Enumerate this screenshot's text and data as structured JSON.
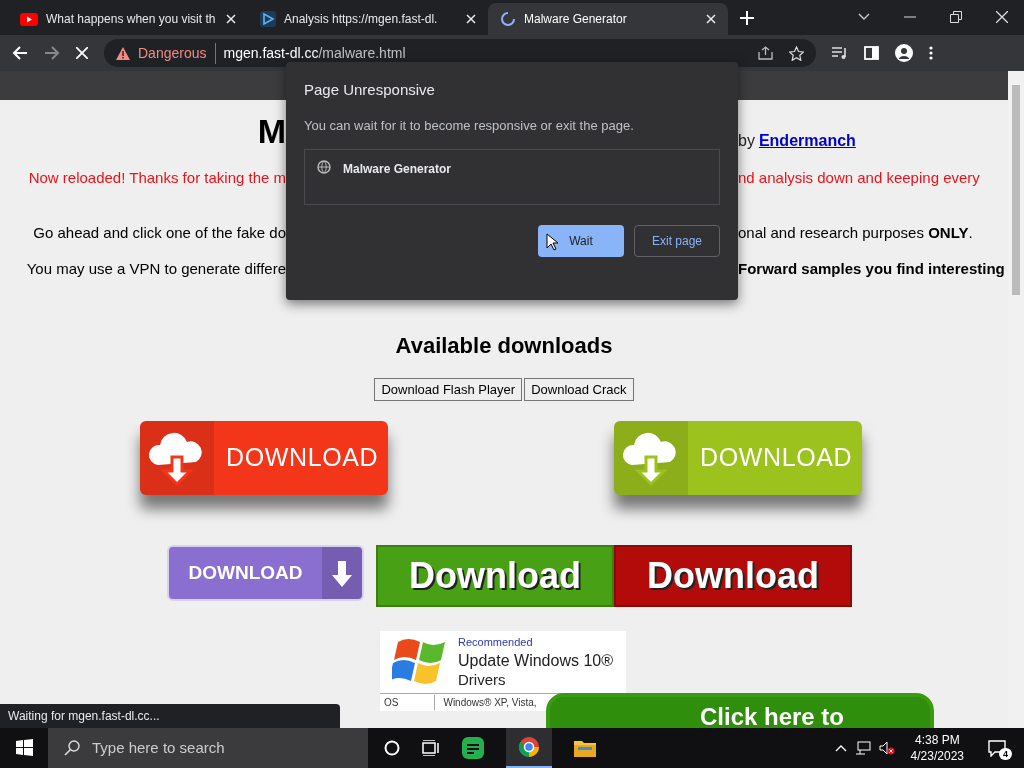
{
  "tabs": [
    {
      "title": "What happens when you visit th",
      "selected": false
    },
    {
      "title": "Analysis https://mgen.fast-dl.",
      "selected": false
    },
    {
      "title": "Malware Generator",
      "selected": true
    }
  ],
  "address": {
    "security": "Dangerous",
    "host": "mgen.fast-dl.cc",
    "path": "/malware.html"
  },
  "dialog": {
    "title": "Page Unresponsive",
    "message": "You can wait for it to become responsive or exit the page.",
    "item": "Malware Generator",
    "buttons": [
      {
        "label": "Wait",
        "selected": true
      },
      {
        "label": "Exit page",
        "selected": false
      }
    ]
  },
  "page": {
    "title_fragment": "M",
    "byline": "by",
    "author": "Endermanch",
    "lines": [
      {
        "color": "#e8141c",
        "left": "Now reloaded! Thanks for taking the m",
        "right": "nd analysis down and keeping every",
        "right_bold": false
      },
      {
        "color": "#000000",
        "left": "Go ahead and click one of the fake do",
        "right": "onal and research purposes **ONLY**.",
        "right_bold": false
      },
      {
        "color": "#000000",
        "left": "You may use a VPN to generate differe",
        "right": "Forward samples you find interesting",
        "right_bold": true
      }
    ],
    "heading": "Available downloads",
    "buttons": [
      "Download Flash Player",
      "Download Crack"
    ],
    "banners": [
      {
        "kind": "cloud",
        "label": "DOWNLOAD",
        "color": "#f3361a"
      },
      {
        "kind": "cloud",
        "label": "DOWNLOAD",
        "color": "#9cc21e"
      }
    ],
    "badges": [
      {
        "kind": "arrow",
        "label": "DOWNLOAD",
        "color": "#8a6fd0"
      },
      {
        "kind": "plain",
        "label": "Download",
        "color": "#48a014"
      },
      {
        "kind": "plain",
        "label": "Download",
        "color": "#b30a0a"
      }
    ],
    "ad": {
      "tag": "Recommended",
      "title": "Update Windows 10®",
      "subtitle": "Drivers",
      "os_label": "OS",
      "os_value": "Windows® XP, Vista,"
    },
    "cta": "Click here to"
  },
  "status": "Waiting for mgen.fast-dl.cc...",
  "taskbar": {
    "search_placeholder": "Type here to search",
    "time": "4:38 PM",
    "date": "4/23/2023",
    "notifications": "4"
  }
}
